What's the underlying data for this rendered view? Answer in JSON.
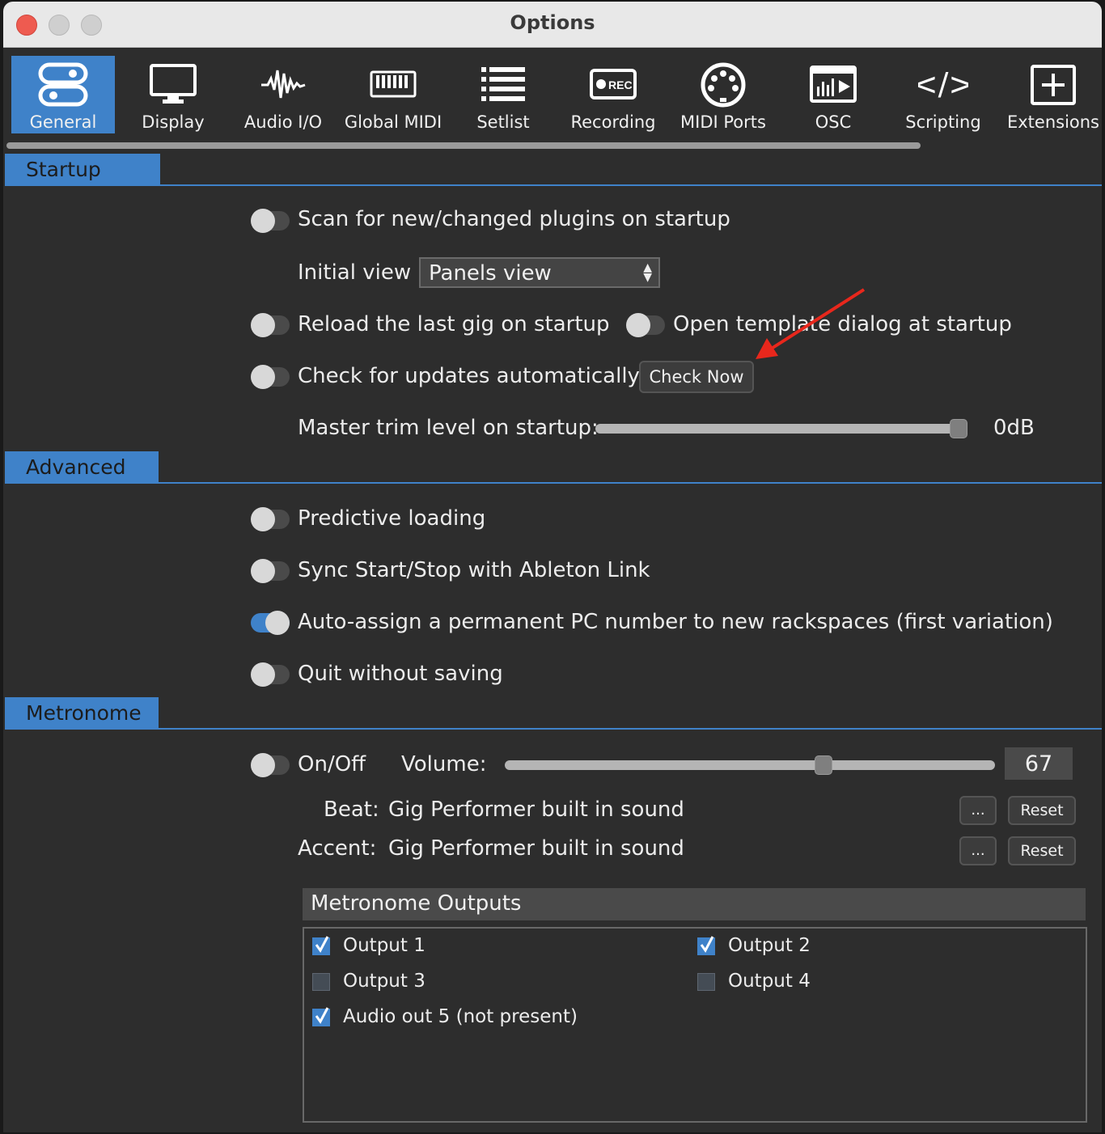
{
  "window": {
    "title": "Options"
  },
  "toolbar": {
    "items": [
      {
        "label": "General",
        "icon": "general-icon",
        "active": true
      },
      {
        "label": "Display",
        "icon": "display-icon"
      },
      {
        "label": "Audio I/O",
        "icon": "waveform-icon"
      },
      {
        "label": "Global MIDI",
        "icon": "keyboard-icon"
      },
      {
        "label": "Setlist",
        "icon": "list-icon"
      },
      {
        "label": "Recording",
        "icon": "record-icon",
        "badge": "REC"
      },
      {
        "label": "MIDI Ports",
        "icon": "midi-din-icon"
      },
      {
        "label": "OSC",
        "icon": "osc-icon"
      },
      {
        "label": "Scripting",
        "icon": "code-icon",
        "glyph": "</>"
      },
      {
        "label": "Extensions",
        "icon": "plus-box-icon"
      }
    ]
  },
  "startup": {
    "section_label": "Startup",
    "scan_plugins": {
      "label": "Scan for new/changed plugins on startup",
      "on": false
    },
    "initial_view": {
      "label": "Initial view",
      "value": "Panels view"
    },
    "reload_last_gig": {
      "label": "Reload the last gig on startup",
      "on": false
    },
    "open_template_dialog": {
      "label": "Open template dialog at startup",
      "on": false
    },
    "check_updates": {
      "label": "Check for updates automatically",
      "on": false
    },
    "check_now_button": "Check Now",
    "master_trim": {
      "label": "Master trim level on startup:",
      "value_text": "0dB",
      "level": 1.0
    }
  },
  "advanced": {
    "section_label": "Advanced",
    "predictive_loading": {
      "label": "Predictive loading",
      "on": false
    },
    "sync_ableton": {
      "label": "Sync Start/Stop with Ableton Link",
      "on": false
    },
    "auto_assign_pc": {
      "label": "Auto-assign a permanent PC number to new rackspaces (first variation)",
      "on": true
    },
    "quit_without_saving": {
      "label": "Quit without saving",
      "on": false
    }
  },
  "metronome": {
    "section_label": "Metronome",
    "onoff": {
      "label": "On/Off",
      "on": false
    },
    "volume": {
      "label": "Volume:",
      "value": "67",
      "level": 0.67
    },
    "beat": {
      "label": "Beat:",
      "value": "Gig Performer built in sound",
      "browse": "...",
      "reset": "Reset"
    },
    "accent": {
      "label": "Accent:",
      "value": "Gig Performer built in sound",
      "browse": "...",
      "reset": "Reset"
    },
    "outputs": {
      "title": "Metronome Outputs",
      "items": [
        {
          "label": "Output 1",
          "checked": true
        },
        {
          "label": "Output 2",
          "checked": true
        },
        {
          "label": "Output 3",
          "checked": false
        },
        {
          "label": "Output 4",
          "checked": false
        },
        {
          "label": "Audio out 5 (not present)",
          "checked": true
        }
      ]
    }
  },
  "colors": {
    "accent": "#3f82c9",
    "annotation_arrow": "#e8271c",
    "background": "#2d2d2d"
  }
}
